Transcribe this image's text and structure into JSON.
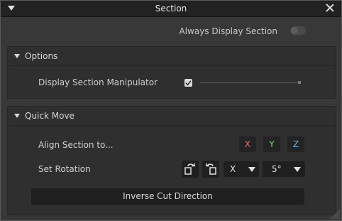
{
  "window": {
    "title": "Section"
  },
  "always_display": {
    "label": "Always Display Section",
    "enabled": false
  },
  "options_panel": {
    "title": "Options",
    "display_manipulator": {
      "label": "Display Section Manipulator",
      "checked": true
    }
  },
  "quick_move_panel": {
    "title": "Quick Move",
    "align": {
      "label": "Align Section to...",
      "buttons": [
        {
          "label": "X",
          "color": "#e06b6b"
        },
        {
          "label": "Y",
          "color": "#7fd07f"
        },
        {
          "label": "Z",
          "color": "#6fb4e8"
        }
      ]
    },
    "rotation": {
      "label": "Set Rotation",
      "axis_value": "X",
      "angle_value": "5°"
    },
    "inverse_button": "Inverse Cut Direction"
  },
  "icons": [
    "menu-triangle-icon",
    "close-icon",
    "rotate-cw-icon",
    "rotate-ccw-icon",
    "resize-grip-icon"
  ]
}
